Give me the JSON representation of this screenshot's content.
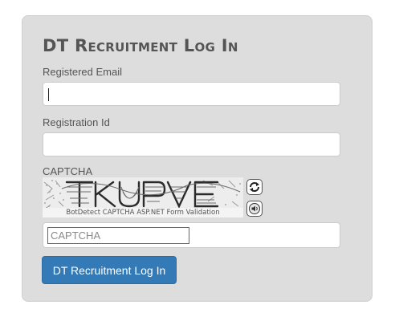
{
  "form": {
    "title": "DT Recruitment Log In",
    "email_label": "Registered Email",
    "email_value": "",
    "registration_label": "Registration Id",
    "registration_value": "",
    "captcha_label": "CAPTCHA",
    "captcha_image": {
      "footer_text": "BotDetect CAPTCHA ASP.NET Form Validation"
    },
    "reload_icon": "reload-icon",
    "sound_icon": "speaker-icon",
    "captcha_placeholder": "CAPTCHA",
    "captcha_value": "",
    "submit_label": "DT Recruitment Log In"
  },
  "colors": {
    "panel_background": "#dddddd",
    "button_primary": "#337ab7",
    "title_text": "#555555"
  }
}
